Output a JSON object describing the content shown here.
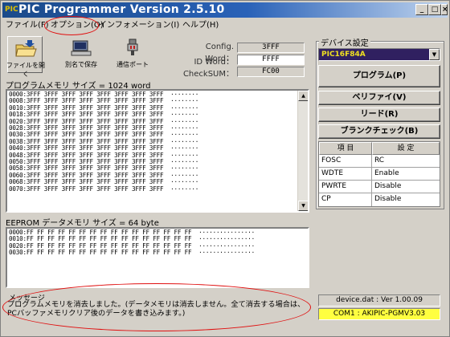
{
  "window": {
    "title": "PIC Programmer Version 2.5.10",
    "app_icon_text": "PIC",
    "minimize": "_",
    "maximize": "□",
    "close": "×"
  },
  "menu": {
    "file": "ファイル(F)",
    "options": "オプション(O)",
    "information": "インフォメーション(I)",
    "help": "ヘルプ(H)"
  },
  "toolbar": {
    "open_label": "ファイルを開く",
    "save_as_label": "別名で保存",
    "comm_port_label": "通信ポート"
  },
  "config": {
    "config_word_label": "Config. Word：",
    "config_word_value": "3FFF",
    "id_word_label": "ID Word：",
    "id_word_value": "FFFF",
    "checksum_label": "CheckSUM：",
    "checksum_value": "FC00"
  },
  "program_memory": {
    "label": "プログラムメモリ サイズ  = 1024 word",
    "lines": [
      "0000:3FFF 3FFF 3FFF 3FFF 3FFF 3FFF 3FFF 3FFF  ········",
      "0008:3FFF 3FFF 3FFF 3FFF 3FFF 3FFF 3FFF 3FFF  ········",
      "0010:3FFF 3FFF 3FFF 3FFF 3FFF 3FFF 3FFF 3FFF  ········",
      "0018:3FFF 3FFF 3FFF 3FFF 3FFF 3FFF 3FFF 3FFF  ········",
      "0020:3FFF 3FFF 3FFF 3FFF 3FFF 3FFF 3FFF 3FFF  ········",
      "0028:3FFF 3FFF 3FFF 3FFF 3FFF 3FFF 3FFF 3FFF  ········",
      "0030:3FFF 3FFF 3FFF 3FFF 3FFF 3FFF 3FFF 3FFF  ········",
      "0038:3FFF 3FFF 3FFF 3FFF 3FFF 3FFF 3FFF 3FFF  ········",
      "0040:3FFF 3FFF 3FFF 3FFF 3FFF 3FFF 3FFF 3FFF  ········",
      "0048:3FFF 3FFF 3FFF 3FFF 3FFF 3FFF 3FFF 3FFF  ········",
      "0050:3FFF 3FFF 3FFF 3FFF 3FFF 3FFF 3FFF 3FFF  ········",
      "0058:3FFF 3FFF 3FFF 3FFF 3FFF 3FFF 3FFF 3FFF  ········",
      "0060:3FFF 3FFF 3FFF 3FFF 3FFF 3FFF 3FFF 3FFF  ········",
      "0068:3FFF 3FFF 3FFF 3FFF 3FFF 3FFF 3FFF 3FFF  ········",
      "0070:3FFF 3FFF 3FFF 3FFF 3FFF 3FFF 3FFF 3FFF  ········"
    ]
  },
  "eeprom_memory": {
    "label": "EEPROM データメモリ サイズ  = 64 byte",
    "lines": [
      "0000:FF FF FF FF FF FF FF FF FF FF FF FF FF FF FF FF  ················",
      "0010:FF FF FF FF FF FF FF FF FF FF FF FF FF FF FF FF  ················",
      "0020:FF FF FF FF FF FF FF FF FF FF FF FF FF FF FF FF  ················",
      "0030:FF FF FF FF FF FF FF FF FF FF FF FF FF FF FF FF  ················"
    ]
  },
  "message": {
    "label": "メッセージ",
    "text_line1": "プログラムメモリを消去しました。(データメモリは消去しません。全て消去する場合は、",
    "text_line2": "PCバッファメモリクリア後のデータを書き込みます。)"
  },
  "device": {
    "group_title": "デバイス設定",
    "selected": "PIC16F84A",
    "program_button": "プログラム(P)",
    "verify_button": "ベリファイ(V)",
    "read_button": "リード(R)",
    "blank_check_button": "ブランクチェック(B)",
    "table_headers": [
      "項 目",
      "設 定"
    ],
    "table_rows": [
      {
        "item": "FOSC",
        "setting": "RC"
      },
      {
        "item": "WDTE",
        "setting": "Enable"
      },
      {
        "item": "PWRTE",
        "setting": "Disable"
      },
      {
        "item": "CP",
        "setting": "Disable"
      }
    ]
  },
  "status": {
    "device_dat": "device.dat : Ver 1.00.09",
    "com_port": "COM1 : AKIPIC-PGMV3.03",
    "com_port_bg": "#ffff40"
  },
  "colors": {
    "annotation": "#e01010",
    "combo_bg": "#302060",
    "combo_text": "#f0e020"
  }
}
